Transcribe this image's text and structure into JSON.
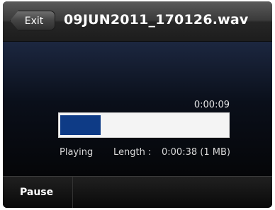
{
  "header": {
    "exit_label": "Exit",
    "title": "09JUN2011_170126.wav"
  },
  "player": {
    "elapsed": "0:00:09",
    "status": "Playing",
    "length_label": "Length :",
    "length_value": "0:00:38 (1 MB)",
    "progress_fraction": 0.24,
    "progress_color": "#0e3b86"
  },
  "softkeys": {
    "pause_label": "Pause"
  }
}
